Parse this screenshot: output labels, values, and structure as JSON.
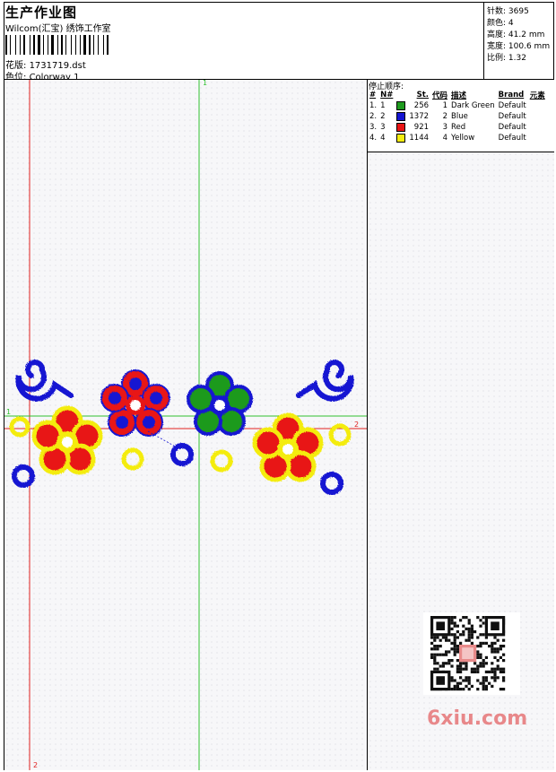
{
  "header": {
    "title": "生产作业图",
    "company": "Wilcom(汇宝) 绣饰工作室",
    "design_label": "花版:",
    "design_value": "1731719.dst",
    "colorway_label": "色位:",
    "colorway_value": "Colorway 1"
  },
  "stats": {
    "stitches_label": "针数:",
    "stitches_value": "3695",
    "colors_label": "颜色:",
    "colors_value": "4",
    "height_label": "高度:",
    "height_value": "41.2 mm",
    "width_label": "宽度:",
    "width_value": "100.6 mm",
    "scale_label": "比例:",
    "scale_value": "1.32"
  },
  "stop_sequence": {
    "title": "停止顺序:",
    "columns": [
      "#",
      "N#",
      "St.",
      "代码",
      "描述",
      "Brand",
      "元素"
    ],
    "rows": [
      {
        "idx": "1.",
        "n": "1",
        "color": "#1e9a1e",
        "st": "256",
        "code": "1",
        "desc": "Dark Green",
        "brand": "Default"
      },
      {
        "idx": "2.",
        "n": "2",
        "color": "#1414d2",
        "st": "1372",
        "code": "2",
        "desc": "Blue",
        "brand": "Default"
      },
      {
        "idx": "3.",
        "n": "3",
        "color": "#e81414",
        "st": "921",
        "code": "3",
        "desc": "Red",
        "brand": "Default"
      },
      {
        "idx": "4.",
        "n": "4",
        "color": "#f4ec10",
        "st": "1144",
        "code": "4",
        "desc": "Yellow",
        "brand": "Default"
      }
    ]
  },
  "guides": {
    "v1_label": "1",
    "v2_label": "2",
    "h1_label": "1",
    "h2_label": "2"
  },
  "watermark": "6xiu.com",
  "colors": {
    "green": "#1e9a1e",
    "blue": "#1414d2",
    "red": "#e81414",
    "yellow": "#f4ec10",
    "guide_red": "#e02020",
    "guide_green": "#30c030"
  }
}
